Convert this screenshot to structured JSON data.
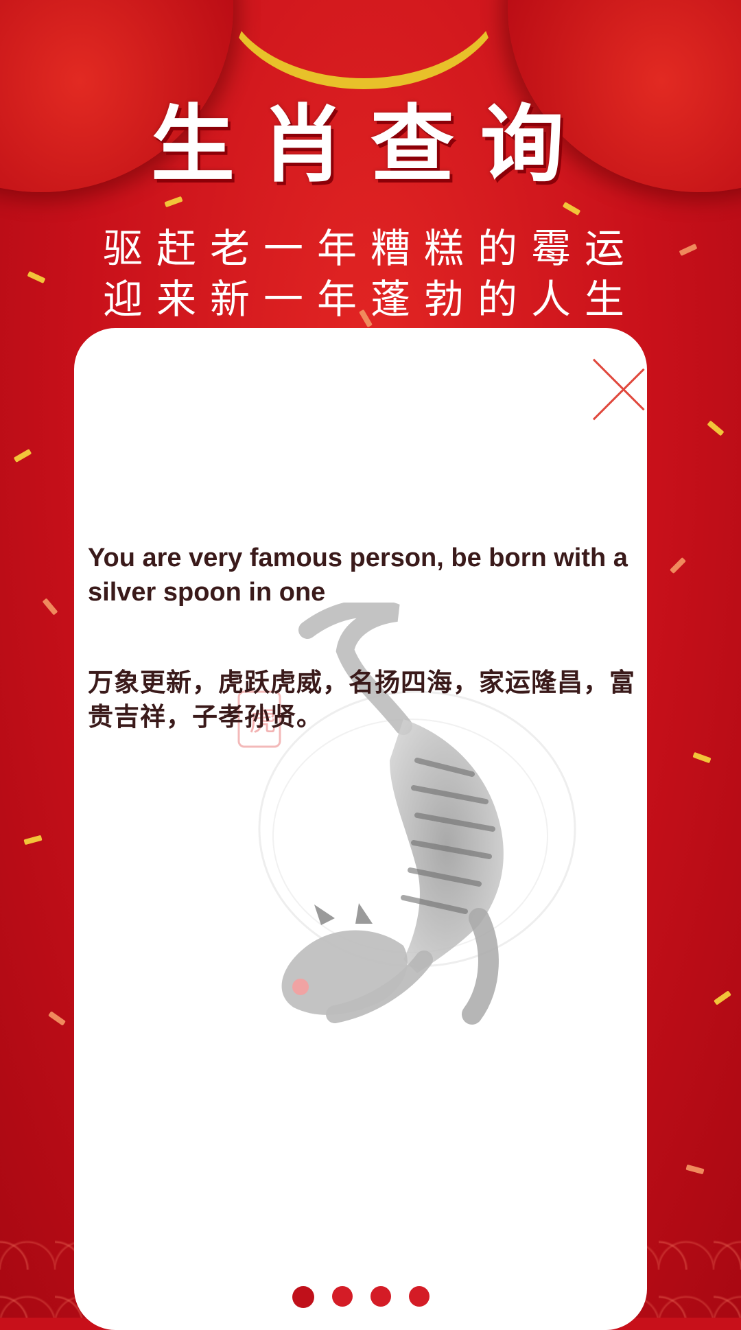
{
  "header": {
    "title": "生肖查询",
    "subtitle_line1": "驱赶老一年糟糕的霉运",
    "subtitle_line2": "迎来新一年蓬勃的人生"
  },
  "card": {
    "english_text": "You are very famous person, be born with a silver spoon in one",
    "chinese_text": "万象更新，虎跃虎威，名扬四海，家运隆昌，富贵吉祥，子孝孙贤。",
    "seal_char": "虎",
    "zodiac_icon": "tiger-ink-icon"
  },
  "pagination": {
    "count": 4,
    "active_index": 0
  },
  "colors": {
    "background_red": "#c8101a",
    "gold": "#e8c12a",
    "card": "#ffffff",
    "text_dark": "#3a1a1a",
    "close_red": "#e0473c"
  }
}
